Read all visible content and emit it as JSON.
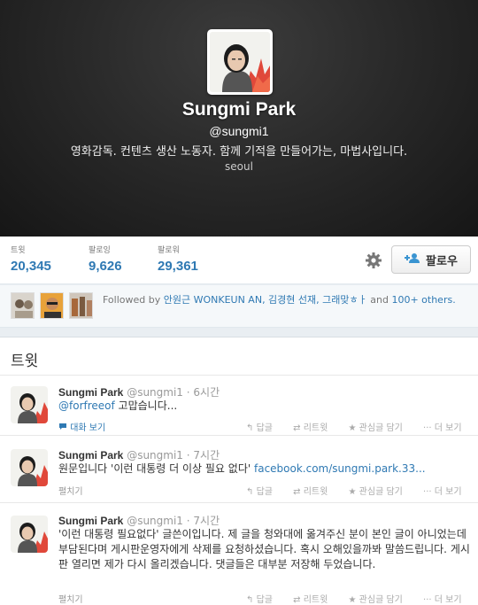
{
  "profile": {
    "name": "Sungmi Park",
    "handle": "@sungmi1",
    "bio": "영화감독. 컨텐츠 생산 노동자. 함께 기적을 만들어가는, 마법사입니다.",
    "location": "seoul"
  },
  "stats": [
    {
      "label": "트윗",
      "value": "20,345"
    },
    {
      "label": "팔로잉",
      "value": "9,626"
    },
    {
      "label": "팔로워",
      "value": "29,361"
    }
  ],
  "follow_button": {
    "label": "팔로우"
  },
  "followed_by": {
    "prefix": "Followed by",
    "names": "안원근 WONKEUN AN, 김경현 선재, 그래맞ㅎㅏ",
    "and": "and",
    "more": "100+ others."
  },
  "tweets_section": {
    "title": "트윗"
  },
  "tweets": [
    {
      "name": "Sungmi Park",
      "handle": "@sungmi1",
      "time": "· 6시간",
      "mention": "@forfreeof",
      "text": " 고맙습니다...",
      "link": "",
      "footer": "대화 보기",
      "actions": {
        "reply": "답글",
        "retweet": "리트윗",
        "fav": "관심글 담기",
        "more": "더 보기"
      }
    },
    {
      "name": "Sungmi Park",
      "handle": "@sungmi1",
      "time": "· 7시간",
      "mention": "",
      "text": "원문입니다 '이런 대통령 더 이상 필요 없다' ",
      "link": "facebook.com/sungmi.park.33...",
      "footer": "펼치기",
      "actions": {
        "reply": "답글",
        "retweet": "리트윗",
        "fav": "관심글 담기",
        "more": "더 보기"
      }
    },
    {
      "name": "Sungmi Park",
      "handle": "@sungmi1",
      "time": "· 7시간",
      "mention": "",
      "text": "'이런 대통령 필요없다' 글쓴이입니다. 제 글을 청와대에 옮겨주신 분이 본인 글이 아니었는데 부담된다며 게시판운영자에게 삭제를 요청하셨습니다. 혹시 오해있을까봐 말씀드립니다. 게시판 열리면 제가 다시 올리겠습니다. 댓글들은 대부분 저장해 두었습니다.",
      "link": "",
      "footer": "펼치기",
      "actions": {
        "reply": "답글",
        "retweet": "리트윗",
        "fav": "관심글 담기",
        "more": "더 보기"
      }
    }
  ],
  "colors": {
    "link": "#2f79b3",
    "header_bg": "#2a2a2a",
    "accent_leaf": "#e0483a"
  }
}
